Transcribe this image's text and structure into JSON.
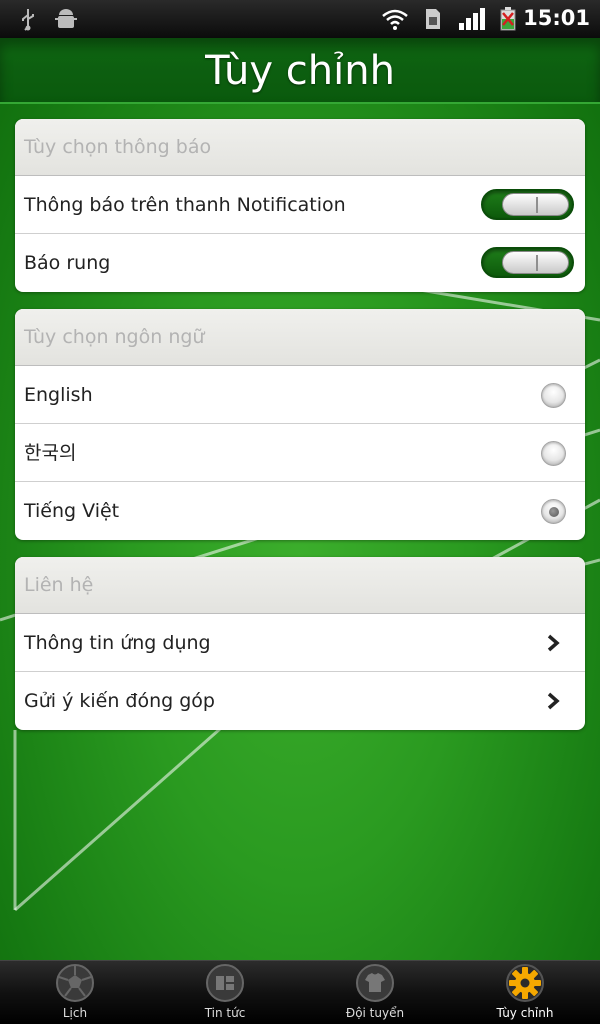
{
  "status_bar": {
    "time": "15:01",
    "icons": [
      "usb-icon",
      "android-debug-icon",
      "wifi-icon",
      "sd-card-icon",
      "signal-icon",
      "battery-icon"
    ]
  },
  "header": {
    "title": "Tùy chỉnh"
  },
  "sections": {
    "notifications": {
      "header": "Tùy chọn thông báo",
      "items": [
        {
          "label": "Thông báo trên thanh Notification",
          "on": true
        },
        {
          "label": "Báo rung",
          "on": true
        }
      ]
    },
    "language": {
      "header": "Tùy chọn ngôn ngữ",
      "items": [
        {
          "label": "English",
          "selected": false
        },
        {
          "label": "한국의",
          "selected": false
        },
        {
          "label": "Tiếng Việt",
          "selected": true
        }
      ]
    },
    "contact": {
      "header": "Liên hệ",
      "items": [
        {
          "label": "Thông tin ứng dụng"
        },
        {
          "label": "Gửi ý kiến đóng góp"
        }
      ]
    }
  },
  "tabbar": {
    "tabs": [
      {
        "label": "Lịch",
        "icon": "soccer-ball-icon",
        "active": false
      },
      {
        "label": "Tin tức",
        "icon": "news-icon",
        "active": false
      },
      {
        "label": "Đội tuyển",
        "icon": "jersey-icon",
        "active": false
      },
      {
        "label": "Tùy chỉnh",
        "icon": "gear-icon",
        "active": true
      }
    ]
  },
  "colors": {
    "accent_green": "#1a8a1a",
    "field_green": "#2a9a20",
    "active_gear": "#f5a800"
  }
}
